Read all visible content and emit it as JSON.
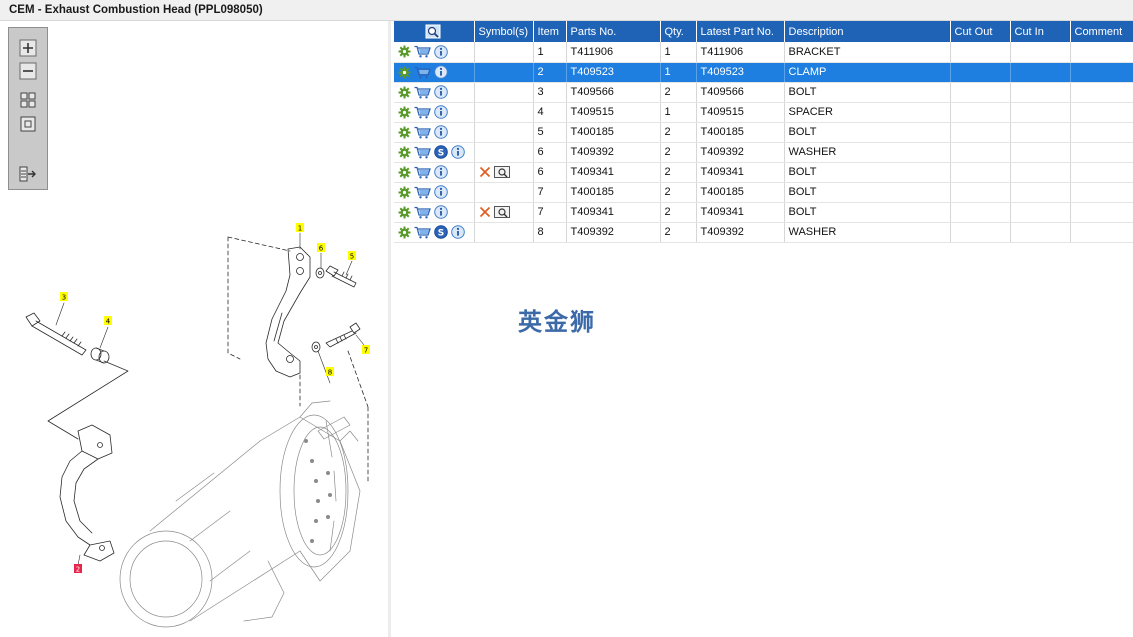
{
  "window": {
    "title": "CEM - Exhaust Combustion Head (PPL098050)"
  },
  "toolbar": {
    "buttons": [
      {
        "icon": "zoom-in-icon"
      },
      {
        "icon": "zoom-out-icon"
      },
      {
        "icon": "fit-view-icon"
      },
      {
        "icon": "actual-size-icon"
      },
      {
        "icon": "export-icon"
      }
    ]
  },
  "diagram": {
    "callouts": [
      "1",
      "6",
      "5",
      "3",
      "4",
      "7",
      "8",
      "2"
    ]
  },
  "table": {
    "headers": {
      "search": "",
      "symbols": "Symbol(s)",
      "item": "Item",
      "parts_no": "Parts No.",
      "qty": "Qty.",
      "latest_part_no": "Latest Part No.",
      "description": "Description",
      "cut_out": "Cut Out",
      "cut_in": "Cut In",
      "comment": "Comment"
    },
    "selected_row": 1,
    "rows": [
      {
        "item": "1",
        "parts_no": "T411906",
        "qty": "1",
        "latest_part_no": "T411906",
        "description": "BRACKET",
        "supersession": false,
        "symbols": false,
        "cut_out": "",
        "cut_in": "",
        "comment": ""
      },
      {
        "item": "2",
        "parts_no": "T409523",
        "qty": "1",
        "latest_part_no": "T409523",
        "description": "CLAMP",
        "supersession": false,
        "symbols": false,
        "cut_out": "",
        "cut_in": "",
        "comment": ""
      },
      {
        "item": "3",
        "parts_no": "T409566",
        "qty": "2",
        "latest_part_no": "T409566",
        "description": "BOLT",
        "supersession": false,
        "symbols": false,
        "cut_out": "",
        "cut_in": "",
        "comment": ""
      },
      {
        "item": "4",
        "parts_no": "T409515",
        "qty": "1",
        "latest_part_no": "T409515",
        "description": "SPACER",
        "supersession": false,
        "symbols": false,
        "cut_out": "",
        "cut_in": "",
        "comment": ""
      },
      {
        "item": "5",
        "parts_no": "T400185",
        "qty": "2",
        "latest_part_no": "T400185",
        "description": "BOLT",
        "supersession": false,
        "symbols": false,
        "cut_out": "",
        "cut_in": "",
        "comment": ""
      },
      {
        "item": "6",
        "parts_no": "T409392",
        "qty": "2",
        "latest_part_no": "T409392",
        "description": "WASHER",
        "supersession": true,
        "symbols": false,
        "cut_out": "",
        "cut_in": "",
        "comment": ""
      },
      {
        "item": "6",
        "parts_no": "T409341",
        "qty": "2",
        "latest_part_no": "T409341",
        "description": "BOLT",
        "supersession": false,
        "symbols": true,
        "cut_out": "",
        "cut_in": "",
        "comment": ""
      },
      {
        "item": "7",
        "parts_no": "T400185",
        "qty": "2",
        "latest_part_no": "T400185",
        "description": "BOLT",
        "supersession": false,
        "symbols": false,
        "cut_out": "",
        "cut_in": "",
        "comment": ""
      },
      {
        "item": "7",
        "parts_no": "T409341",
        "qty": "2",
        "latest_part_no": "T409341",
        "description": "BOLT",
        "supersession": false,
        "symbols": true,
        "cut_out": "",
        "cut_in": "",
        "comment": ""
      },
      {
        "item": "8",
        "parts_no": "T409392",
        "qty": "2",
        "latest_part_no": "T409392",
        "description": "WASHER",
        "supersession": true,
        "symbols": false,
        "cut_out": "",
        "cut_in": "",
        "comment": ""
      }
    ]
  },
  "watermark": {
    "text": "英金狮"
  },
  "colors": {
    "header_bg": "#1f63b6",
    "selected_row": "#1e7fe0",
    "callout_yellow": "#ffff00",
    "callout_red": "#e8254a",
    "gear_green": "#5a9a2a",
    "cart_blue": "#2b63b8",
    "info_blue": "#3f7fd0",
    "cross_orange": "#e05a1a"
  }
}
